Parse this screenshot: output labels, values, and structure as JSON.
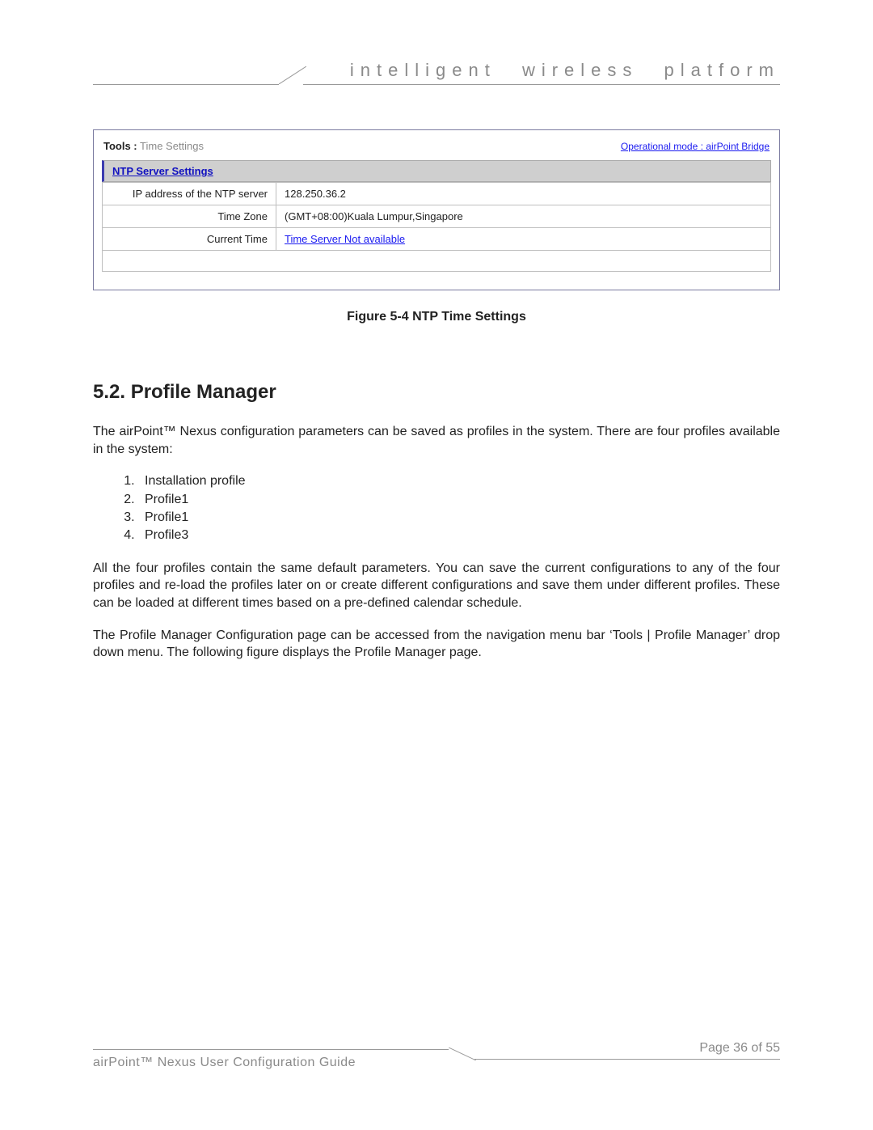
{
  "header": {
    "tagline": "intelligent wireless platform"
  },
  "figure": {
    "title_bold": "Tools :",
    "title_dim": "Time Settings",
    "opmode": "Operational mode : airPoint Bridge",
    "section": "NTP Server Settings",
    "rows": [
      {
        "k": "IP address of the NTP server",
        "v": "128.250.36.2",
        "link": false
      },
      {
        "k": "Time Zone",
        "v": "(GMT+08:00)Kuala Lumpur,Singapore",
        "link": false
      },
      {
        "k": "Current Time",
        "v": "Time Server Not available",
        "link": true
      }
    ],
    "caption": "Figure 5-4 NTP Time Settings"
  },
  "section": {
    "heading": "5.2. Profile Manager",
    "p1": "The airPoint™ Nexus configuration parameters can be saved as profiles in the system. There are four profiles available in the system:",
    "list": [
      "Installation profile",
      "Profile1",
      "Profile1",
      "Profile3"
    ],
    "p2": "All the four profiles contain the same default parameters.  You can save the current configurations to any of the four profiles and re-load the profiles later on or create different configurations and save them under different profiles. These can be loaded at different times based on a pre-defined calendar schedule.",
    "p3": "The Profile Manager Configuration page can be accessed from the navigation menu bar ‘Tools | Profile Manager’ drop down menu. The following figure displays the Profile Manager page."
  },
  "footer": {
    "left": "airPoint™ Nexus User Configuration Guide",
    "right": "Page 36 of 55"
  }
}
